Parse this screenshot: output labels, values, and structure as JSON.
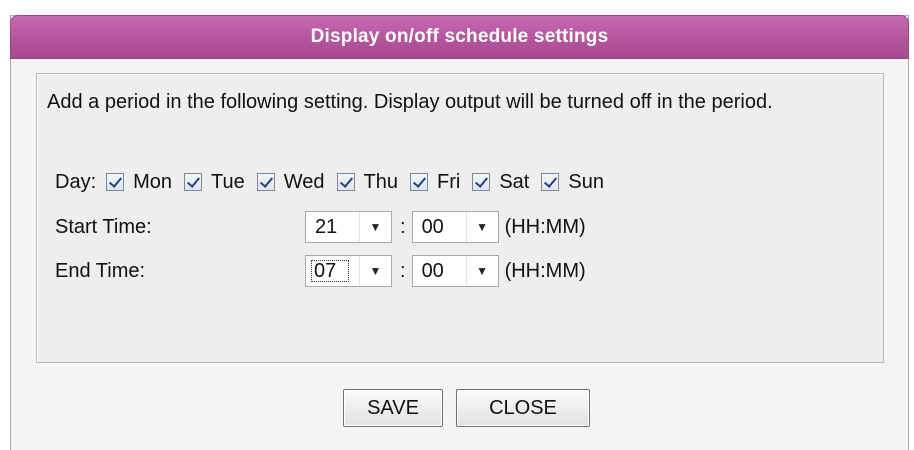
{
  "dialog": {
    "title": "Display on/off schedule settings",
    "intro_text": "Add a period in the following setting. Display output will be turned off in the period."
  },
  "days": {
    "label": "Day:",
    "items": [
      {
        "label": "Mon",
        "checked": true
      },
      {
        "label": "Tue",
        "checked": true
      },
      {
        "label": "Wed",
        "checked": true
      },
      {
        "label": "Thu",
        "checked": true
      },
      {
        "label": "Fri",
        "checked": true
      },
      {
        "label": "Sat",
        "checked": true
      },
      {
        "label": "Sun",
        "checked": true
      }
    ]
  },
  "start_time": {
    "label": "Start Time:",
    "hour": "21",
    "minute": "00",
    "separator": ":",
    "format": "(HH:MM)"
  },
  "end_time": {
    "label": "End Time:",
    "hour": "07",
    "minute": "00",
    "separator": ":",
    "format": "(HH:MM)"
  },
  "buttons": {
    "save_label": "SAVE",
    "close_label": "CLOSE"
  },
  "colors": {
    "title_bar": "#b4559d",
    "panel_bg": "#eeeeee",
    "checkmark": "#23418a"
  },
  "icons": {
    "dropdown": "chevron-down-icon",
    "checkbox": "checkbox-checked-icon"
  }
}
